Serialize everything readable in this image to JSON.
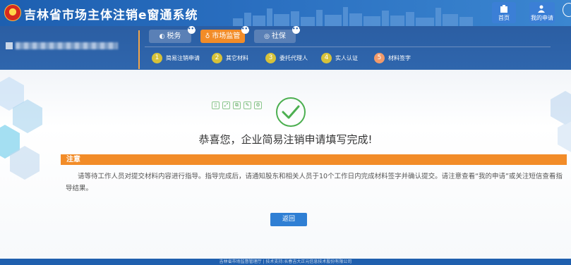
{
  "header": {
    "title": "吉林省市场主体注销e窗通系统",
    "home_label": "首页",
    "my_apps_label": "我的申请"
  },
  "nav": {
    "tabs": [
      {
        "label": "税务",
        "glyph": "◐"
      },
      {
        "label": "市场监管",
        "glyph": "♁"
      },
      {
        "label": "社保",
        "glyph": "◎"
      }
    ],
    "steps": [
      {
        "num": "1",
        "label": "简易注销申请"
      },
      {
        "num": "2",
        "label": "其它材料"
      },
      {
        "num": "3",
        "label": "委托代理人"
      },
      {
        "num": "4",
        "label": "实人认证"
      },
      {
        "num": "5",
        "label": "材料签字"
      }
    ]
  },
  "main": {
    "success_message": "恭喜您，企业简易注销申请填写完成!",
    "notice_title": "注意",
    "notice_body": "请等待工作人员对提交材料内容进行指导。指导完成后，请通知股东和相关人员于10个工作日内完成材料签字并确认提交。请注意查看“我的申请”或关注短信查看指导结果。",
    "back_label": "返回"
  },
  "footer": {
    "text": "吉林省市场监督管理厅 | 技术支持:长春吉大正元信息技术股份有限公司"
  },
  "colors": {
    "header_blue": "#2a6fc0",
    "accent_orange": "#f28c28",
    "success_green": "#4caf50",
    "button_blue": "#2f7fd4"
  }
}
